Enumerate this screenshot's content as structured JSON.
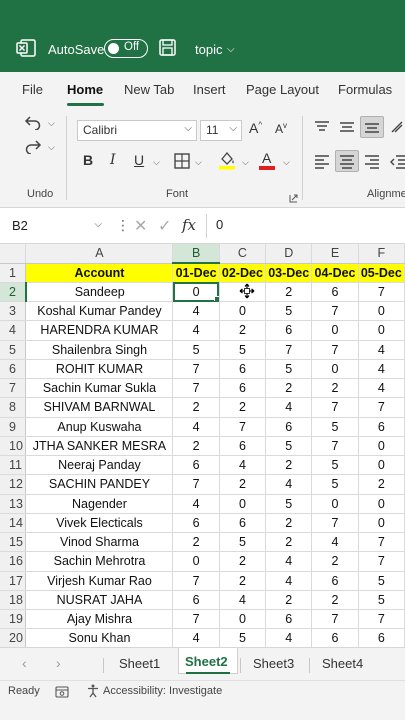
{
  "titlebar": {
    "autosave_label": "AutoSave",
    "toggle_state": "Off",
    "doc_title": "topic",
    "accent": "#207245"
  },
  "ribbon_tabs": [
    {
      "label": "File",
      "active": false
    },
    {
      "label": "Home",
      "active": true
    },
    {
      "label": "New Tab",
      "active": false
    },
    {
      "label": "Insert",
      "active": false
    },
    {
      "label": "Page Layout",
      "active": false
    },
    {
      "label": "Formulas",
      "active": false
    }
  ],
  "ribbon": {
    "undo_group_label": "Undo",
    "font_group_label": "Font",
    "alignment_group_label": "Alignme",
    "font_name": "Calibri",
    "font_size": "11",
    "grow_font": "A",
    "shrink_font": "A",
    "bold": "B",
    "italic": "I",
    "underline": "U",
    "font_color_letter": "A",
    "highlight_color": "#ffff00",
    "font_color": "#e02020"
  },
  "formula_bar": {
    "name_box": "B2",
    "fx": "fx",
    "value": "0"
  },
  "grid": {
    "column_headers": [
      "A",
      "B",
      "C",
      "D",
      "E",
      "F"
    ],
    "selected_column": "B",
    "selected_row": "2",
    "rows": [
      {
        "n": "1",
        "cells": [
          "Account",
          "01-Dec",
          "02-Dec",
          "03-Dec",
          "04-Dec",
          "05-Dec"
        ]
      },
      {
        "n": "2",
        "cells": [
          "Sandeep",
          "0",
          "",
          "2",
          "6",
          "7"
        ]
      },
      {
        "n": "3",
        "cells": [
          "Koshal Kumar Pandey",
          "4",
          "0",
          "5",
          "7",
          "0"
        ]
      },
      {
        "n": "4",
        "cells": [
          "HARENDRA KUMAR",
          "4",
          "2",
          "6",
          "0",
          "0"
        ]
      },
      {
        "n": "5",
        "cells": [
          "Shailenbra Singh",
          "5",
          "5",
          "7",
          "7",
          "4"
        ]
      },
      {
        "n": "6",
        "cells": [
          "ROHIT KUMAR",
          "7",
          "6",
          "5",
          "0",
          "4"
        ]
      },
      {
        "n": "7",
        "cells": [
          "Sachin Kumar Sukla",
          "7",
          "6",
          "2",
          "2",
          "4"
        ]
      },
      {
        "n": "8",
        "cells": [
          "SHIVAM BARNWAL",
          "2",
          "2",
          "4",
          "7",
          "7"
        ]
      },
      {
        "n": "9",
        "cells": [
          "Anup Kuswaha",
          "4",
          "7",
          "6",
          "5",
          "6"
        ]
      },
      {
        "n": "10",
        "cells": [
          "JTHA SANKER MESRA",
          "2",
          "6",
          "5",
          "7",
          "0"
        ]
      },
      {
        "n": "11",
        "cells": [
          "Neeraj Panday",
          "6",
          "4",
          "2",
          "5",
          "0"
        ]
      },
      {
        "n": "12",
        "cells": [
          "SACHIN PANDEY",
          "7",
          "2",
          "4",
          "5",
          "2"
        ]
      },
      {
        "n": "13",
        "cells": [
          "Nagender",
          "4",
          "0",
          "5",
          "0",
          "0"
        ]
      },
      {
        "n": "14",
        "cells": [
          "Vivek Electicals",
          "6",
          "6",
          "2",
          "7",
          "0"
        ]
      },
      {
        "n": "15",
        "cells": [
          "Vinod Sharma",
          "2",
          "5",
          "2",
          "4",
          "7"
        ]
      },
      {
        "n": "16",
        "cells": [
          "Sachin Mehrotra",
          "0",
          "2",
          "4",
          "2",
          "7"
        ]
      },
      {
        "n": "17",
        "cells": [
          "Virjesh Kumar Rao",
          "7",
          "2",
          "4",
          "6",
          "5"
        ]
      },
      {
        "n": "18",
        "cells": [
          "NUSRAT JAHA",
          "6",
          "4",
          "2",
          "2",
          "5"
        ]
      },
      {
        "n": "19",
        "cells": [
          "Ajay Mishra",
          "7",
          "0",
          "6",
          "7",
          "7"
        ]
      },
      {
        "n": "20",
        "cells": [
          "Sonu  Khan",
          "4",
          "5",
          "4",
          "6",
          "6"
        ]
      }
    ]
  },
  "sheet_tabs": [
    {
      "label": "Sheet1",
      "active": false
    },
    {
      "label": "Sheet2",
      "active": true
    },
    {
      "label": "Sheet3",
      "active": false
    },
    {
      "label": "Sheet4",
      "active": false
    }
  ],
  "statusbar": {
    "ready": "Ready",
    "accessibility": "Accessibility: Investigate"
  }
}
